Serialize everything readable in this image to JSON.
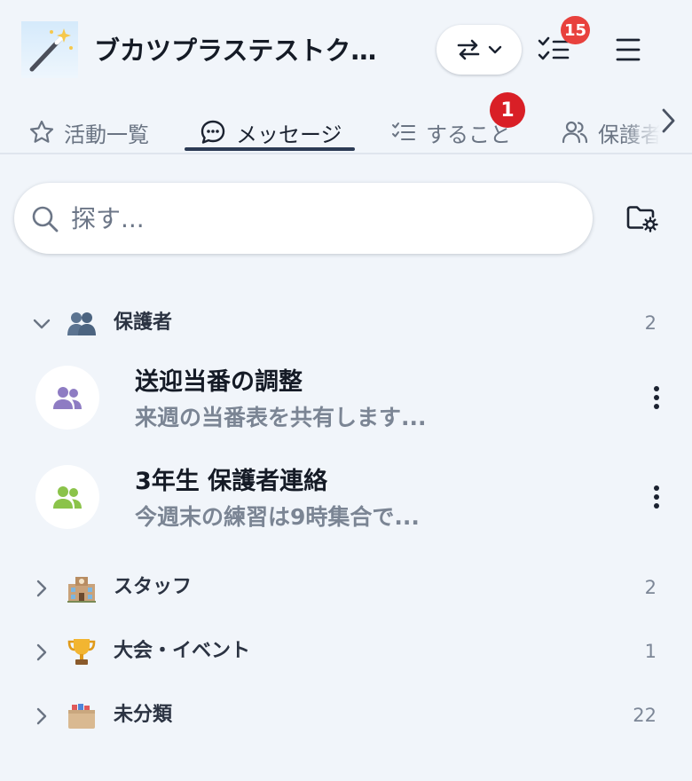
{
  "header": {
    "team_name": "ブカツプラステストク…",
    "todo_badge": "15",
    "icons": {
      "team_avatar": "magic-wand-icon",
      "switch": "swap-arrows-icon",
      "dropdown": "chevron-down-icon",
      "todo": "checklist-icon",
      "menu": "hamburger-icon"
    }
  },
  "tabs": {
    "active_index": 1,
    "items": [
      {
        "label": "活動一覧",
        "icon": "star-icon"
      },
      {
        "label": "メッセージ",
        "icon": "chat-bubble-icon"
      },
      {
        "label": "すること",
        "icon": "checklist-icon",
        "badge": "1"
      },
      {
        "label": "保護者",
        "icon": "people-icon"
      }
    ],
    "scroll_icon": "chevron-right-icon"
  },
  "search": {
    "placeholder": "探す...",
    "value": "",
    "icon": "search-icon",
    "folder_icon": "folder-settings-icon"
  },
  "groups": [
    {
      "label": "保護者",
      "emoji": "👥",
      "count": "2",
      "expanded": true,
      "threads": [
        {
          "title": "送迎当番の調整",
          "preview": "来週の当番表を共有します...",
          "avatar_color": "#8e7cc3"
        },
        {
          "title": "3年生 保護者連絡",
          "preview": "今週末の練習は9時集合で...",
          "avatar_color": "#8bc34a"
        }
      ]
    },
    {
      "label": "スタッフ",
      "emoji": "🏫",
      "count": "2",
      "expanded": false
    },
    {
      "label": "大会・イベント",
      "emoji": "🏆",
      "count": "1",
      "expanded": false
    },
    {
      "label": "未分類",
      "emoji": "🗂️",
      "count": "22",
      "expanded": false
    }
  ],
  "colors": {
    "background": "#f1f5fa",
    "badge_red": "#e8413d",
    "tab_badge_red": "#d91f26",
    "active_tab_underline": "#2c3b55"
  }
}
